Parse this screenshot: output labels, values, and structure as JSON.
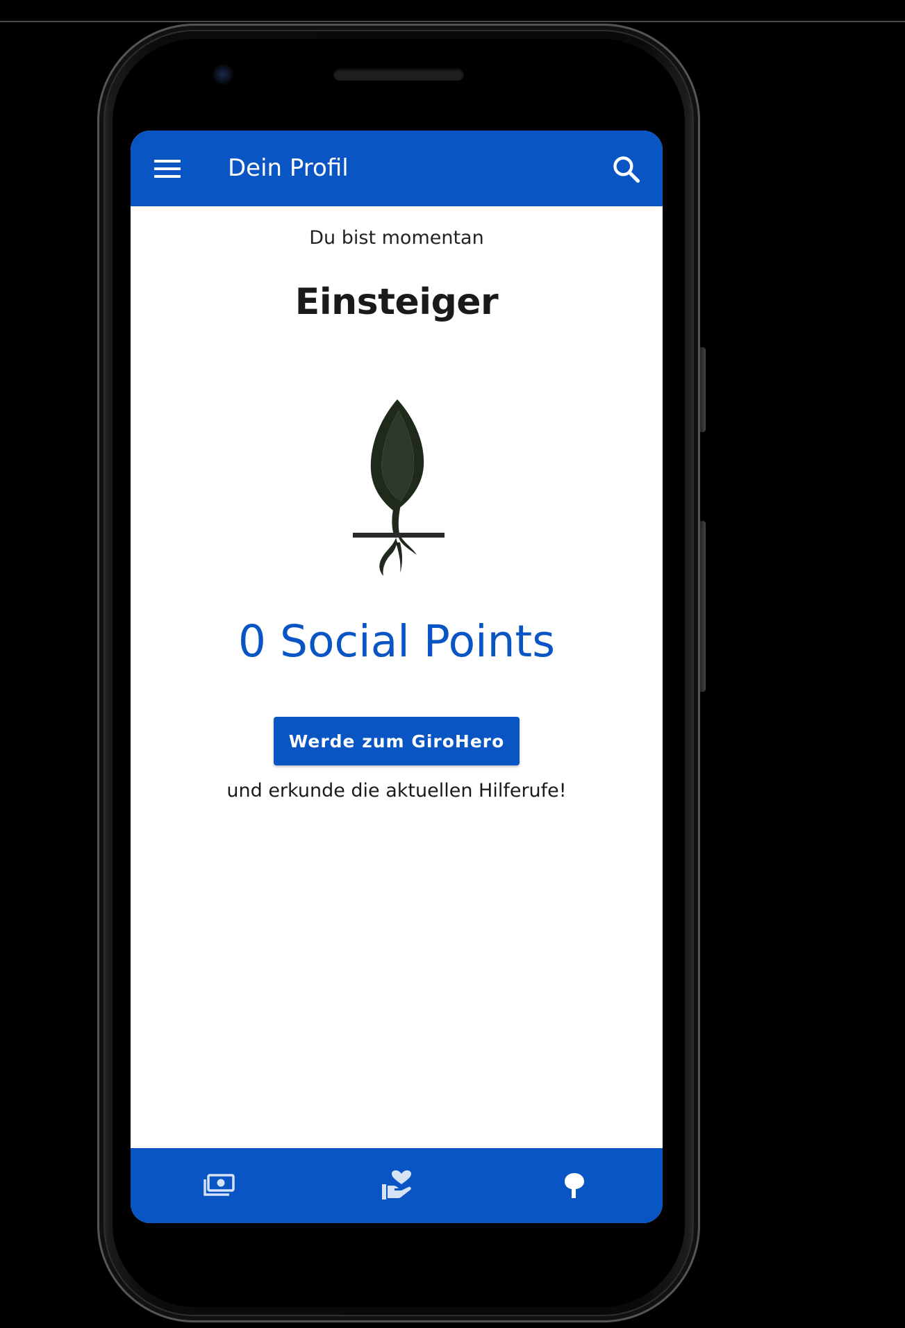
{
  "app_bar": {
    "title": "Dein Profil",
    "menu_icon": "menu-icon",
    "search_icon": "search-icon"
  },
  "profile": {
    "status_intro": "Du bist momentan",
    "level": "Einsteiger",
    "level_icon": "sprout-icon",
    "points_text": "0 Social Points",
    "cta_label": "Werde zum GiroHero",
    "cta_hint": "und erkunde die aktuellen Hilferufe!"
  },
  "bottom_nav": {
    "items": [
      {
        "icon": "money-icon"
      },
      {
        "icon": "helping-hand-heart-icon"
      },
      {
        "icon": "tree-icon"
      }
    ]
  },
  "colors": {
    "primary": "#0a55c4",
    "background": "#ffffff",
    "text": "#1a1a1a"
  }
}
